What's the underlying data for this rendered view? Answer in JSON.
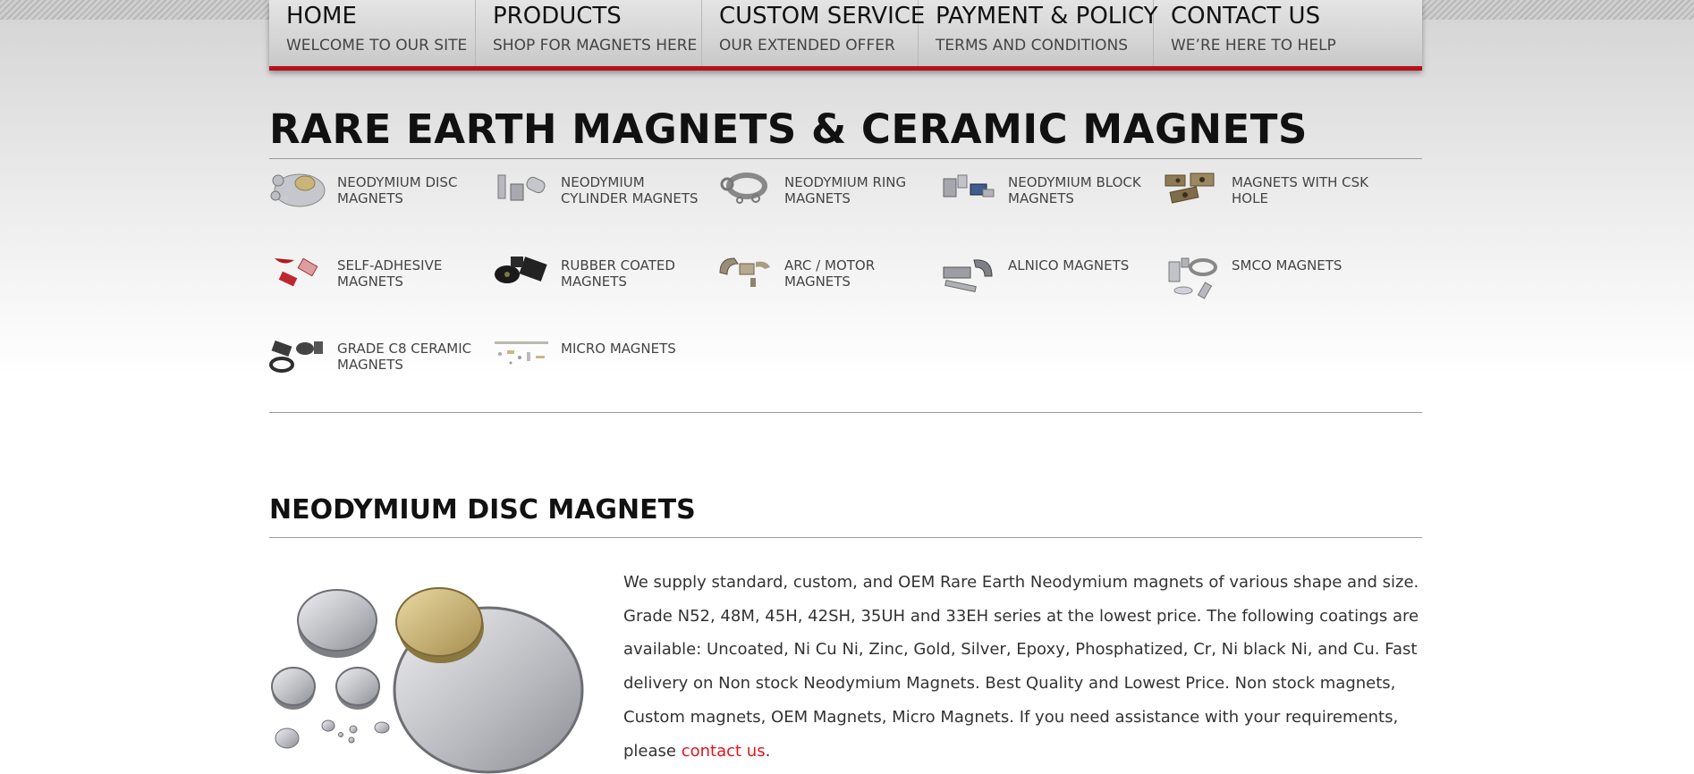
{
  "nav": [
    {
      "title": "HOME",
      "sub": "WELCOME TO OUR SITE"
    },
    {
      "title": "PRODUCTS",
      "sub": "SHOP FOR MAGNETS HERE"
    },
    {
      "title": "CUSTOM SERVICE",
      "sub": "OUR EXTENDED OFFER"
    },
    {
      "title": "PAYMENT & POLICY",
      "sub": "TERMS AND CONDITIONS"
    },
    {
      "title": "CONTACT US",
      "sub": "WE’RE HERE TO HELP"
    }
  ],
  "page_title": "RARE EARTH MAGNETS & CERAMIC MAGNETS",
  "categories": [
    {
      "label": "NEODYMIUM DISC MAGNETS"
    },
    {
      "label": "NEODYMIUM CYLINDER MAGNETS"
    },
    {
      "label": "NEODYMIUM RING MAGNETS"
    },
    {
      "label": "NEODYMIUM BLOCK MAGNETS"
    },
    {
      "label": "MAGNETS WITH CSK HOLE"
    },
    {
      "label": "SELF-ADHESIVE MAGNETS"
    },
    {
      "label": "RUBBER COATED MAGNETS"
    },
    {
      "label": "ARC / MOTOR MAGNETS"
    },
    {
      "label": "ALNICO MAGNETS"
    },
    {
      "label": "SMCO MAGNETS"
    },
    {
      "label": "GRADE C8 CERAMIC MAGNETS"
    },
    {
      "label": "MICRO MAGNETS"
    }
  ],
  "section": {
    "title": "NEODYMIUM DISC MAGNETS",
    "description": "We supply standard, custom, and OEM Rare Earth Neodymium magnets of various shape and size. Grade N52, 48M, 45H, 42SH, 35UH and 33EH series at the lowest price. The following coatings are available: Uncoated, Ni Cu Ni, Zinc, Gold, Silver, Epoxy, Phosphatized, Cr, Ni black Ni, and Cu. Fast delivery on Non stock Neodymium Magnets. Best Quality and Lowest Price. Non stock magnets, Custom magnets, OEM Magnets, Micro Magnets. If you need assistance with your requirements, please ",
    "contact_link": "contact us",
    "end": "."
  },
  "colors": {
    "accent_red": "#b3121b",
    "link_red": "#e3141c"
  }
}
